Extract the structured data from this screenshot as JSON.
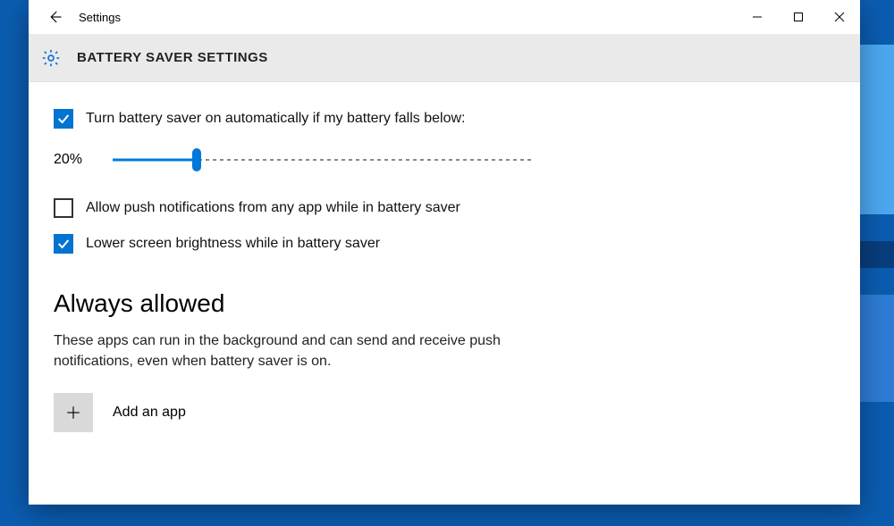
{
  "titlebar": {
    "app_name": "Settings"
  },
  "header": {
    "page_title": "BATTERY SAVER SETTINGS"
  },
  "settings": {
    "auto_on": {
      "checked": true,
      "label": "Turn battery saver on automatically if my battery falls below:"
    },
    "threshold": {
      "display": "20%",
      "percent": 20
    },
    "allow_push": {
      "checked": false,
      "label": "Allow push notifications from any app while in battery saver"
    },
    "lower_brightness": {
      "checked": true,
      "label": "Lower screen brightness while in battery saver"
    }
  },
  "always_allowed": {
    "heading": "Always allowed",
    "description": "These apps can run in the background and can send and receive push notifications, even when battery saver is on.",
    "add_label": "Add an app"
  },
  "colors": {
    "accent": "#0078d7"
  }
}
